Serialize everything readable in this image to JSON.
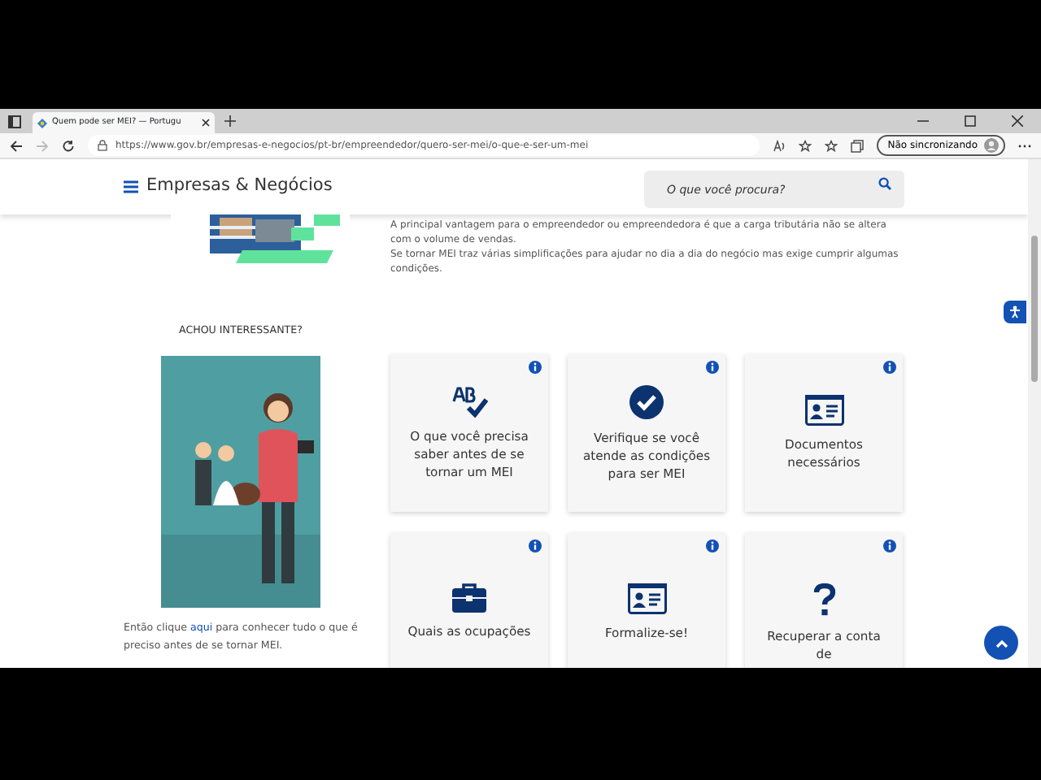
{
  "browser": {
    "tab_title": "Quem pode ser MEI? — Portugu",
    "url": "https://www.gov.br/empresas-e-negocios/pt-br/empreendedor/quero-ser-mei/o-que-e-ser-um-mei",
    "profile": "Não sincronizando",
    "forward_disabled": true
  },
  "header": {
    "title": "Empresas & Negócios",
    "search_placeholder": "O que você procura?"
  },
  "intro": [
    "A principal vantagem para o empreendedor ou empreendedora é que a  carga tributária não se altera com o volume de vendas.",
    "Se tornar MEI traz várias simplificações para ajudar no dia a dia do negócio mas exige cumprir algumas condições."
  ],
  "sidebar": {
    "heading": "ACHOU INTERESSANTE?",
    "text_before": "Então clique ",
    "link": "aqui",
    "text_after": " para conhecer tudo o que é preciso antes de se tornar MEI."
  },
  "cards": [
    {
      "kind": "spelling",
      "label": "O que você precisa saber antes de se tornar um MEI"
    },
    {
      "kind": "check",
      "label": "Verifique se você atende as condições para ser MEI"
    },
    {
      "kind": "id-card",
      "label": "Documentos necessários"
    },
    {
      "kind": "briefcase",
      "label": "Quais as ocupações"
    },
    {
      "kind": "id-card",
      "label": "Formalize-se!"
    },
    {
      "kind": "question",
      "label": "Recuperar a conta de"
    }
  ]
}
